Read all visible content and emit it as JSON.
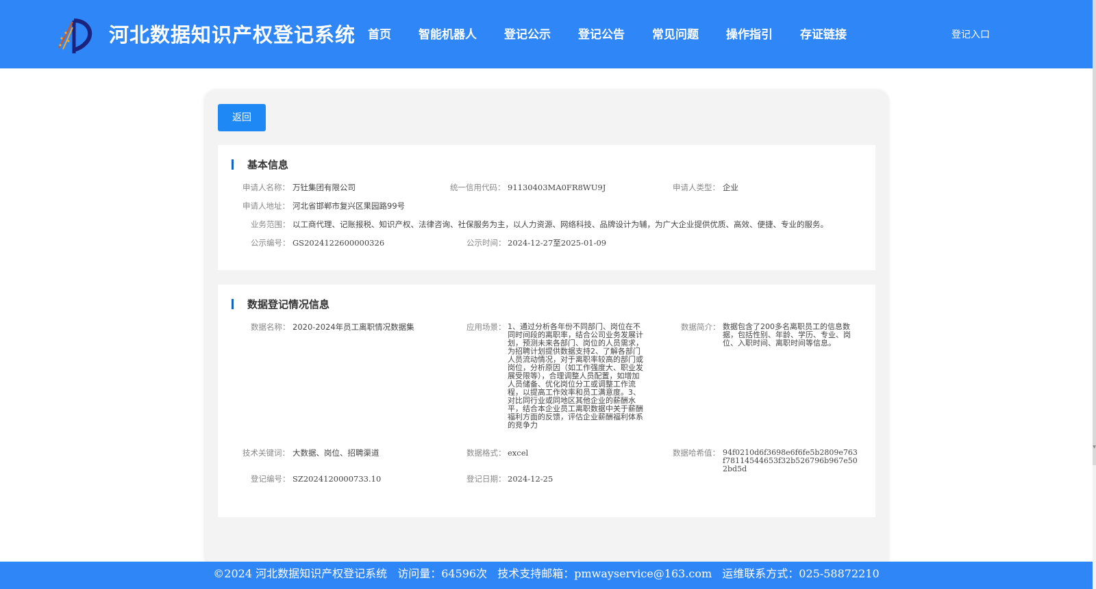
{
  "header": {
    "title": "河北数据知识产权登记系统",
    "nav": [
      "首页",
      "智能机器人",
      "登记公示",
      "登记公告",
      "常见问题",
      "操作指引",
      "存证链接"
    ],
    "login": "登记入口"
  },
  "back_label": "返回",
  "basic": {
    "title": "基本信息",
    "applicant_name_label": "申请人名称：",
    "applicant_name": "万钍集团有限公司",
    "credit_code_label": "统一信用代码：",
    "credit_code": "91130403MA0FR8WU9J",
    "applicant_type_label": "申请人类型：",
    "applicant_type": "企业",
    "address_label": "申请人地址：",
    "address": "河北省邯郸市复兴区果园路99号",
    "scope_label": "业务范围：",
    "scope": "以工商代理、记账报税、知识产权、法律咨询、社保服务为主，以人力资源、网络科技、品牌设计为辅，为广大企业提供优质、高效、便捷、专业的服务。",
    "notice_no_label": "公示编号：",
    "notice_no": "GS2024122600000326",
    "notice_time_label": "公示时间：",
    "notice_time": "2024-12-27至2025-01-09"
  },
  "registration": {
    "title": "数据登记情况信息",
    "data_name_label": "数据名称：",
    "data_name": "2020-2024年员工离职情况数据集",
    "scenario_label": "应用场景：",
    "scenario": "1、通过分析各年份不同部门、岗位在不同时间段的离职率，结合公司业务发展计划，预测未来各部门、岗位的人员需求，为招聘计划提供数据支持2、了解各部门人员流动情况，对于离职率较高的部门或岗位，分析原因（如工作强度大、职业发展受限等），合理调整人员配置，如增加人员储备、优化岗位分工或调整工作流程，以提高工作效率和员工满意度。3、对比同行业或同地区其他企业的薪酬水平，结合本企业员工离职数据中关于薪酬福利方面的反馈，评估企业薪酬福利体系的竞争力",
    "intro_label": "数据简介：",
    "intro": "数据包含了200多名离职员工的信息数据，包括性别、年龄、学历、专业、岗位、入职时间、离职时间等信息。",
    "keywords_label": "技术关键词：",
    "keywords": "大数据、岗位、招聘渠道",
    "format_label": "数据格式：",
    "format": "excel",
    "hash_label": "数据哈希值：",
    "hash": "94f0210d6f3698e6f6fe5b2809e763f78114544653f32b526796b967e502bd5d",
    "reg_no_label": "登记编号：",
    "reg_no": "SZ2024120000733.10",
    "reg_date_label": "登记日期：",
    "reg_date": "2024-12-25"
  },
  "footer": {
    "copyright": "©2024 河北数据知识产权登记系统",
    "visits": "访问量：64596次",
    "email": "技术支持邮箱：pmwayservice@163.com",
    "phone": "运维联系方式：025-58872210"
  }
}
